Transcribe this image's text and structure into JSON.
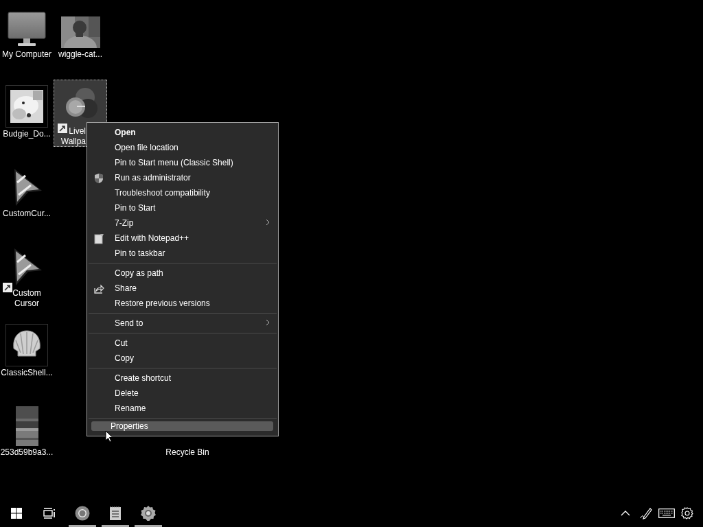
{
  "desktop_icons": [
    {
      "lines": [
        "My Computer"
      ],
      "kind": "monitor",
      "selected": false,
      "shortcut": false,
      "cut": false
    },
    {
      "lines": [
        "wiggle-cat..."
      ],
      "selected": false,
      "shortcut": false,
      "cut": false
    },
    {
      "lines": [
        "Budgie_Do..."
      ],
      "kind": "framed-photo",
      "selected": false,
      "shortcut": false,
      "cut": false
    },
    {
      "lines": [
        "Livel",
        "Wallpa"
      ],
      "kind": "app",
      "selected": true,
      "shortcut": true,
      "cut": true
    },
    {
      "lines": [
        "CustomCur..."
      ],
      "kind": "cursor",
      "selected": false,
      "shortcut": false,
      "cut": false
    },
    {
      "lines": [
        "Custom",
        "Cursor"
      ],
      "kind": "cursor",
      "selected": false,
      "shortcut": true,
      "cut": false
    },
    {
      "lines": [
        "ClassicShell..."
      ],
      "kind": "shell",
      "selected": false,
      "shortcut": false,
      "cut": false
    },
    {
      "lines": [
        "253d59b9a3..."
      ],
      "kind": "tall-photo",
      "selected": false,
      "shortcut": false,
      "cut": false
    },
    {
      "lines": [
        "Recycle Bin"
      ],
      "kind": "none",
      "selected": false,
      "shortcut": false,
      "cut": false
    }
  ],
  "context_menu": {
    "groups": [
      [
        {
          "label": "Open",
          "kind": "text",
          "default": true,
          "submenu": false,
          "selected": false
        },
        {
          "label": "Open file location",
          "kind": "text",
          "default": false,
          "submenu": false,
          "selected": false
        },
        {
          "label": "Pin to Start menu (Classic Shell)",
          "kind": "text",
          "default": false,
          "submenu": false,
          "selected": false
        },
        {
          "label": "Run as administrator",
          "kind": "shield",
          "default": false,
          "submenu": false,
          "selected": false
        },
        {
          "label": "Troubleshoot compatibility",
          "kind": "text",
          "default": false,
          "submenu": false,
          "selected": false
        },
        {
          "label": "Pin to Start",
          "kind": "text",
          "default": false,
          "submenu": false,
          "selected": false
        },
        {
          "label": "7-Zip",
          "kind": "text",
          "default": false,
          "submenu": true,
          "selected": false
        },
        {
          "label": "Edit with Notepad++",
          "kind": "notepad",
          "default": false,
          "submenu": false,
          "selected": false
        },
        {
          "label": "Pin to taskbar",
          "kind": "text",
          "default": false,
          "submenu": false,
          "selected": false
        }
      ],
      [
        {
          "label": "Copy as path",
          "kind": "text",
          "default": false,
          "submenu": false,
          "selected": false
        },
        {
          "label": "Share",
          "kind": "share",
          "default": false,
          "submenu": false,
          "selected": false
        },
        {
          "label": "Restore previous versions",
          "kind": "text",
          "default": false,
          "submenu": false,
          "selected": false
        }
      ],
      [
        {
          "label": "Send to",
          "kind": "text",
          "default": false,
          "submenu": true,
          "selected": false
        }
      ],
      [
        {
          "label": "Cut",
          "kind": "text",
          "default": false,
          "submenu": false,
          "selected": false
        },
        {
          "label": "Copy",
          "kind": "text",
          "default": false,
          "submenu": false,
          "selected": false
        }
      ],
      [
        {
          "label": "Create shortcut",
          "kind": "text",
          "default": false,
          "submenu": false,
          "selected": false
        },
        {
          "label": "Delete",
          "kind": "text",
          "default": false,
          "submenu": false,
          "selected": false
        },
        {
          "label": "Rename",
          "kind": "text",
          "default": false,
          "submenu": false,
          "selected": false
        }
      ],
      [
        {
          "label": "Properties",
          "kind": "text",
          "default": false,
          "submenu": false,
          "selected": true
        }
      ]
    ]
  },
  "taskbar": {
    "buttons": [
      {
        "kind": "start",
        "running": false
      },
      {
        "kind": "task-view",
        "running": false
      },
      {
        "kind": "browser",
        "running": true
      },
      {
        "kind": "notepad",
        "running": true
      },
      {
        "kind": "settings",
        "running": true
      }
    ],
    "tray": [
      {
        "kind": "caret"
      },
      {
        "kind": "pen"
      },
      {
        "kind": "keyboard"
      },
      {
        "kind": "settings"
      }
    ]
  }
}
